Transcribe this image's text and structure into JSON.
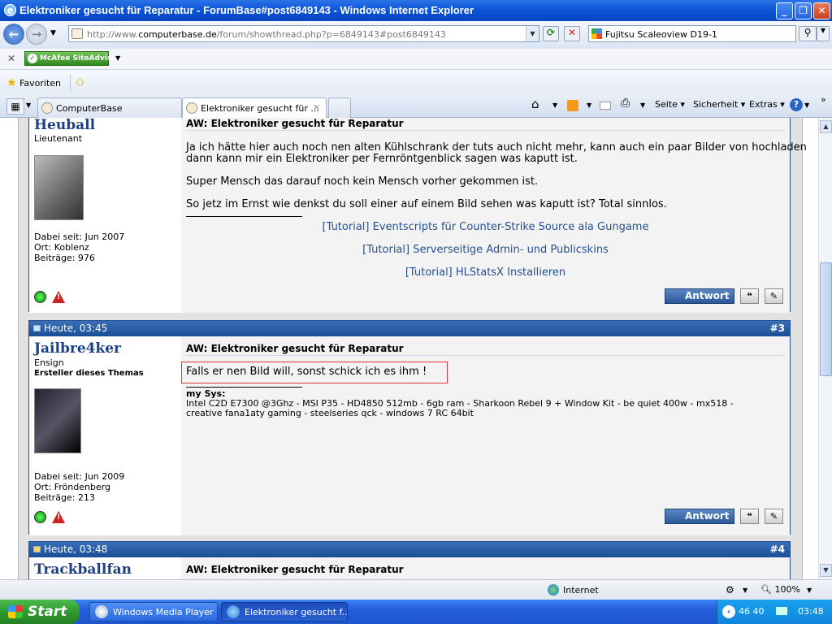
{
  "window": {
    "title": "Elektroniker gesucht für Reparatur - ForumBase#post6849143 - Windows Internet Explorer"
  },
  "nav": {
    "url_prefix": "http://www.",
    "url_domain": "computerbase.de",
    "url_path": "/forum/showthread.php?p=6849143#post6849143",
    "search_value": "Fujitsu Scaleoview D19-1"
  },
  "toolbar": {
    "mcafee_label": "McAfee SiteAdvisor",
    "favorites_label": "Favoriten"
  },
  "tabs": [
    {
      "label": "ComputerBase"
    },
    {
      "label": "Elektroniker gesucht für ..."
    }
  ],
  "commands": {
    "page": "Seite",
    "security": "Sicherheit",
    "extras": "Extras"
  },
  "posts": [
    {
      "username": "Heuball",
      "rank": "Lieutenant",
      "joined": "Dabei seit: Jun 2007",
      "location": "Ort: Koblenz",
      "posts_count": "Beiträge: 976",
      "title": "AW: Elektroniker gesucht für Reparatur",
      "body": [
        "Ja ich hätte hier auch noch nen alten Kühlschrank der tuts auch nicht mehr, kann auch ein paar Bilder von hochladen",
        "dann kann mir ein Elektroniker per Fernröntgenblick sagen was kaputt ist.",
        "Super Mensch das darauf noch kein Mensch vorher gekommen ist.",
        "So jetz im Ernst wie denkst du soll einer auf einem Bild sehen was kaputt ist? Total sinnlos."
      ],
      "signature_links": [
        "[Tutorial] Eventscripts für Counter-Strike Source ala Gungame",
        "[Tutorial] Serverseitige Admin- und Publicskins",
        "[Tutorial] HLStatsX Installieren"
      ],
      "reply_label": "Antwort"
    },
    {
      "date": "Heute, 03:45",
      "number": "#3",
      "username": "Jailbre4ker",
      "rank": "Ensign",
      "badge": "Ersteller dieses Themas",
      "joined": "Dabei seit: Jun 2009",
      "location": "Ort: Fröndenberg",
      "posts_count": "Beiträge: 213",
      "title": "AW: Elektroniker gesucht für Reparatur",
      "body": "Falls er nen Bild will, sonst schick ich es ihm !",
      "sig_label": "my Sys:",
      "sig_line1": "Intel C2D E7300 @3Ghz - MSI P35 - HD4850 512mb - 6gb ram - Sharkoon Rebel 9 + Window Kit - be quiet 400w - mx518 -",
      "sig_line2": "creative fana1aty gaming - steelseries qck - windows 7 RC 64bit",
      "reply_label": "Antwort"
    },
    {
      "date": "Heute, 03:48",
      "number": "#4",
      "username": "Trackballfan",
      "title": "AW: Elektroniker gesucht für Reparatur"
    }
  ],
  "status": {
    "zone": "Internet",
    "zoom": "100%"
  },
  "taskbar": {
    "start_label": "Start",
    "items": [
      {
        "label": "Windows Media Player"
      },
      {
        "label": "Elektroniker gesucht f..."
      }
    ],
    "tray_nums": "46 40",
    "clock": "03:48"
  },
  "colors": {
    "accent": "#1a4d96",
    "link": "#24508e",
    "username": "#1b3f82"
  }
}
